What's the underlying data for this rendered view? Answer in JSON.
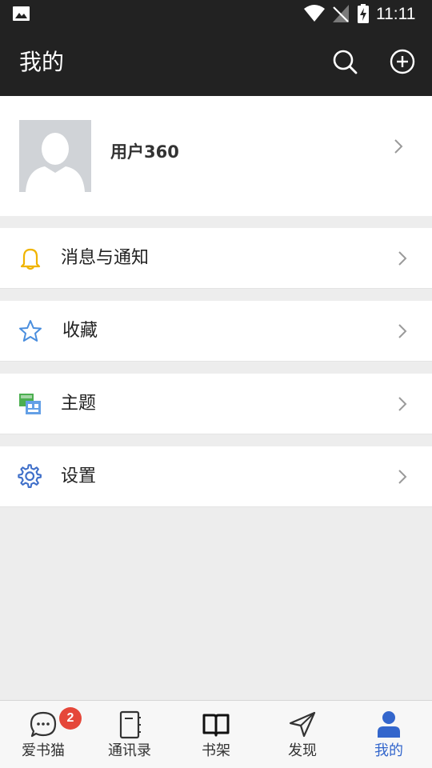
{
  "status_bar": {
    "time": "11:11",
    "icons": [
      "gallery-icon",
      "wifi-icon",
      "no-signal-icon",
      "battery-charging-icon"
    ]
  },
  "app_bar": {
    "title": "我的",
    "actions": [
      "search-icon",
      "add-circle-icon"
    ]
  },
  "profile": {
    "username": "用户360",
    "avatar_icon": "default-avatar-icon"
  },
  "menu": [
    {
      "label": "消息与通知",
      "icon": "bell-icon",
      "icon_color": "#f0b400"
    },
    {
      "label": "收藏",
      "icon": "star-icon",
      "icon_color": "#4a8ede"
    },
    {
      "label": "主题",
      "icon": "theme-icon",
      "icon_color": "#4caf50"
    },
    {
      "label": "设置",
      "icon": "gear-icon",
      "icon_color": "#3f6fc9"
    }
  ],
  "bottom_nav": [
    {
      "label": "爱书猫",
      "icon": "chat-bubble-icon",
      "badge": "2",
      "active": false
    },
    {
      "label": "通讯录",
      "icon": "notebook-icon",
      "active": false
    },
    {
      "label": "书架",
      "icon": "book-icon",
      "active": false
    },
    {
      "label": "发现",
      "icon": "navigation-icon",
      "active": false
    },
    {
      "label": "我的",
      "icon": "person-icon",
      "active": true
    }
  ],
  "colors": {
    "bar_background": "#222222",
    "page_background": "#ededed",
    "accent": "#3366cc",
    "badge": "#e5473a"
  }
}
